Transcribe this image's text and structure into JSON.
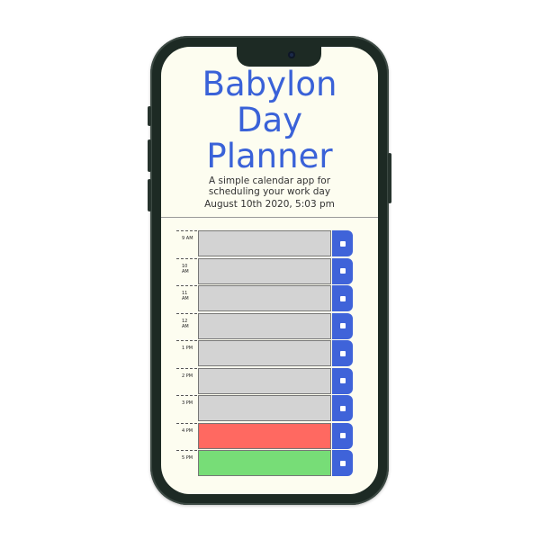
{
  "app": {
    "title_lines": [
      "Babylon",
      "Day",
      "Planner"
    ],
    "subtitle_lines": [
      "A simple calendar app for",
      "scheduling your work day"
    ],
    "current_date": "August 10th 2020, 5:03 pm"
  },
  "colors": {
    "title": "#3a62d8",
    "past": "#d3d3d3",
    "present": "#ff6961",
    "future": "#77dd77",
    "save": "#3f63d9",
    "background": "#fdfdf0"
  },
  "timeblocks": [
    {
      "hour_lines": [
        "9 AM"
      ],
      "state": "past",
      "text": ""
    },
    {
      "hour_lines": [
        "10",
        "AM"
      ],
      "state": "past",
      "text": ""
    },
    {
      "hour_lines": [
        "11",
        "AM"
      ],
      "state": "past",
      "text": ""
    },
    {
      "hour_lines": [
        "12",
        "AM"
      ],
      "state": "past",
      "text": ""
    },
    {
      "hour_lines": [
        "1 PM"
      ],
      "state": "past",
      "text": ""
    },
    {
      "hour_lines": [
        "2 PM"
      ],
      "state": "past",
      "text": ""
    },
    {
      "hour_lines": [
        "3 PM"
      ],
      "state": "past",
      "text": ""
    },
    {
      "hour_lines": [
        "4 PM"
      ],
      "state": "present",
      "text": ""
    },
    {
      "hour_lines": [
        "5 PM"
      ],
      "state": "future",
      "text": ""
    }
  ],
  "icons": {
    "save": "save-icon"
  }
}
